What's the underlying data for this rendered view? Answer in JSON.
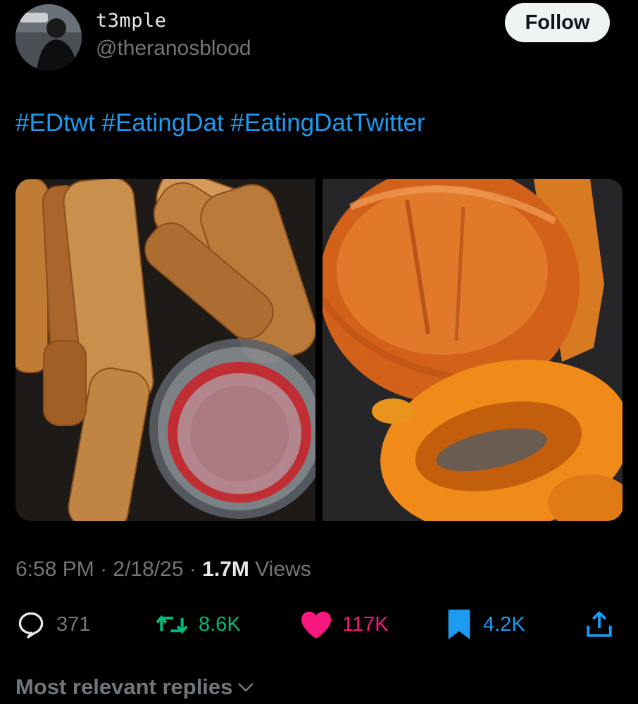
{
  "author": {
    "display_name": "t3mple",
    "handle": "@theranosblood",
    "follow_label": "Follow"
  },
  "tweet": {
    "text": "#EDtwt #EatingDat #EatingDatTwitter",
    "media": [
      {
        "alt": "fried mozzarella sticks with marinara dipping cup"
      },
      {
        "alt": "brioche chicken sandwich with onion rings"
      }
    ]
  },
  "meta": {
    "time": "6:58 PM",
    "date": "2/18/25",
    "views_count": "1.7M",
    "views_label": "Views"
  },
  "actions": {
    "replies": "371",
    "reposts": "8.6K",
    "likes": "117K",
    "bookmarks": "4.2K",
    "colors": {
      "reply": "#71767b",
      "repost": "#00ba7c",
      "like": "#f91880",
      "bookmark": "#1d9bf0",
      "share": "#1d9bf0"
    }
  },
  "replies_sort": {
    "label": "Most relevant replies"
  }
}
